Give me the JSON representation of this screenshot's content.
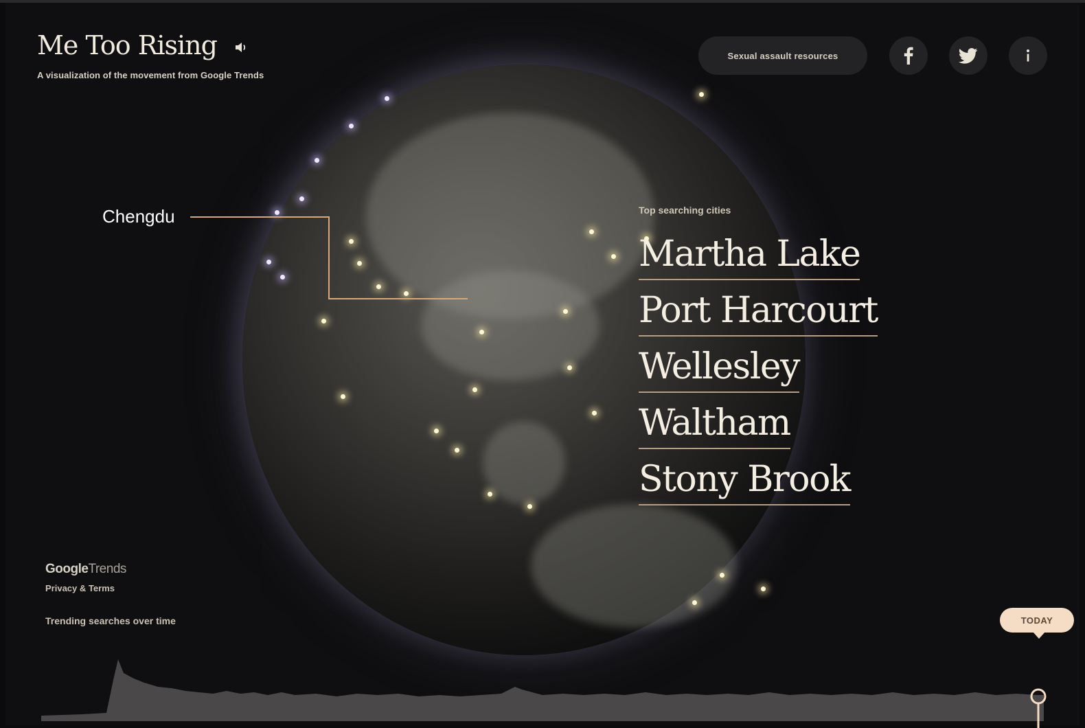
{
  "header": {
    "title": "Me Too Rising",
    "subtitle": "A visualization of the movement from Google Trends",
    "sound_icon": "speaker-icon"
  },
  "toolbar": {
    "resources_label": "Sexual assault resources",
    "facebook_icon": "facebook-icon",
    "twitter_icon": "twitter-icon",
    "info_icon": "info-icon"
  },
  "globe": {
    "highlight_city": "Chengdu",
    "leader_color": "#d7a979"
  },
  "top_cities": {
    "heading": "Top searching cities",
    "items": [
      "Martha Lake",
      "Port Harcourt",
      "Wellesley",
      "Waltham",
      "Stony Brook"
    ]
  },
  "footer": {
    "logo_google": "Google",
    "logo_trends": "Trends",
    "privacy": "Privacy & Terms",
    "trend_heading": "Trending searches over time",
    "today_label": "TODAY"
  },
  "colors": {
    "background": "#0f0e10",
    "accent": "#f5dcc4",
    "city_underline": "#b59e82"
  }
}
